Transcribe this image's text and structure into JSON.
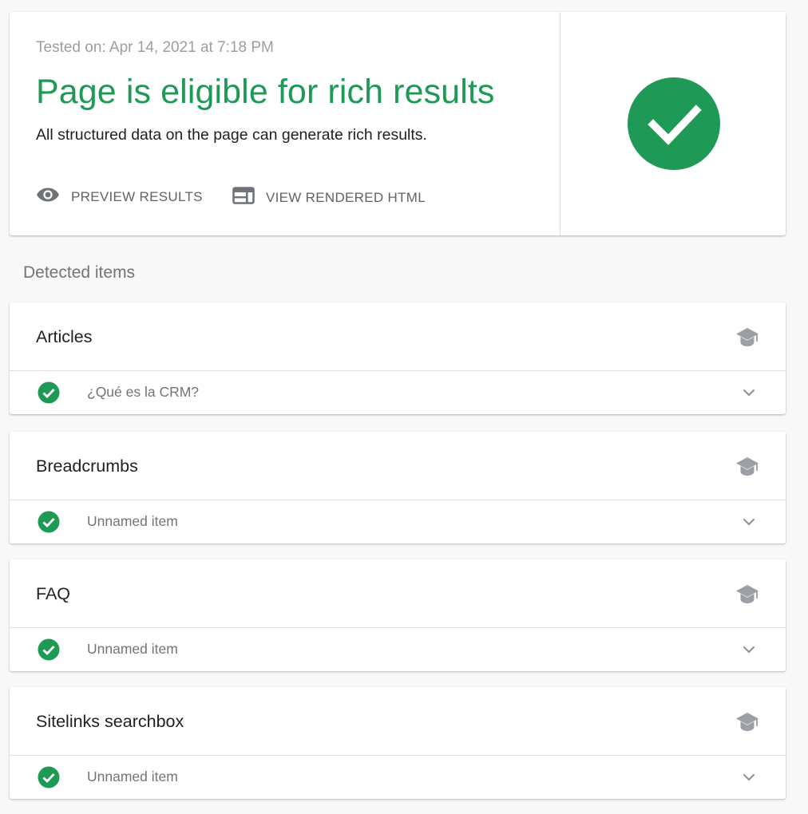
{
  "summary": {
    "tested_on": "Tested on: Apr 14, 2021 at 7:18 PM",
    "headline": "Page is eligible for rich results",
    "subline": "All structured data on the page can generate rich results.",
    "actions": {
      "preview_label": "PREVIEW RESULTS",
      "html_label": "VIEW RENDERED HTML"
    },
    "status_icon": "check-circle-icon"
  },
  "detected": {
    "heading": "Detected items",
    "items": [
      {
        "title": "Articles",
        "row_label": "¿Qué es la CRM?",
        "status": "valid"
      },
      {
        "title": "Breadcrumbs",
        "row_label": "Unnamed item",
        "status": "valid"
      },
      {
        "title": "FAQ",
        "row_label": "Unnamed item",
        "status": "valid"
      },
      {
        "title": "Sitelinks searchbox",
        "row_label": "Unnamed item",
        "status": "valid"
      }
    ]
  },
  "colors": {
    "success": "#1e9a56",
    "text_primary": "#202124",
    "text_secondary": "#70757a",
    "icon_grey": "#9aa0a6"
  }
}
